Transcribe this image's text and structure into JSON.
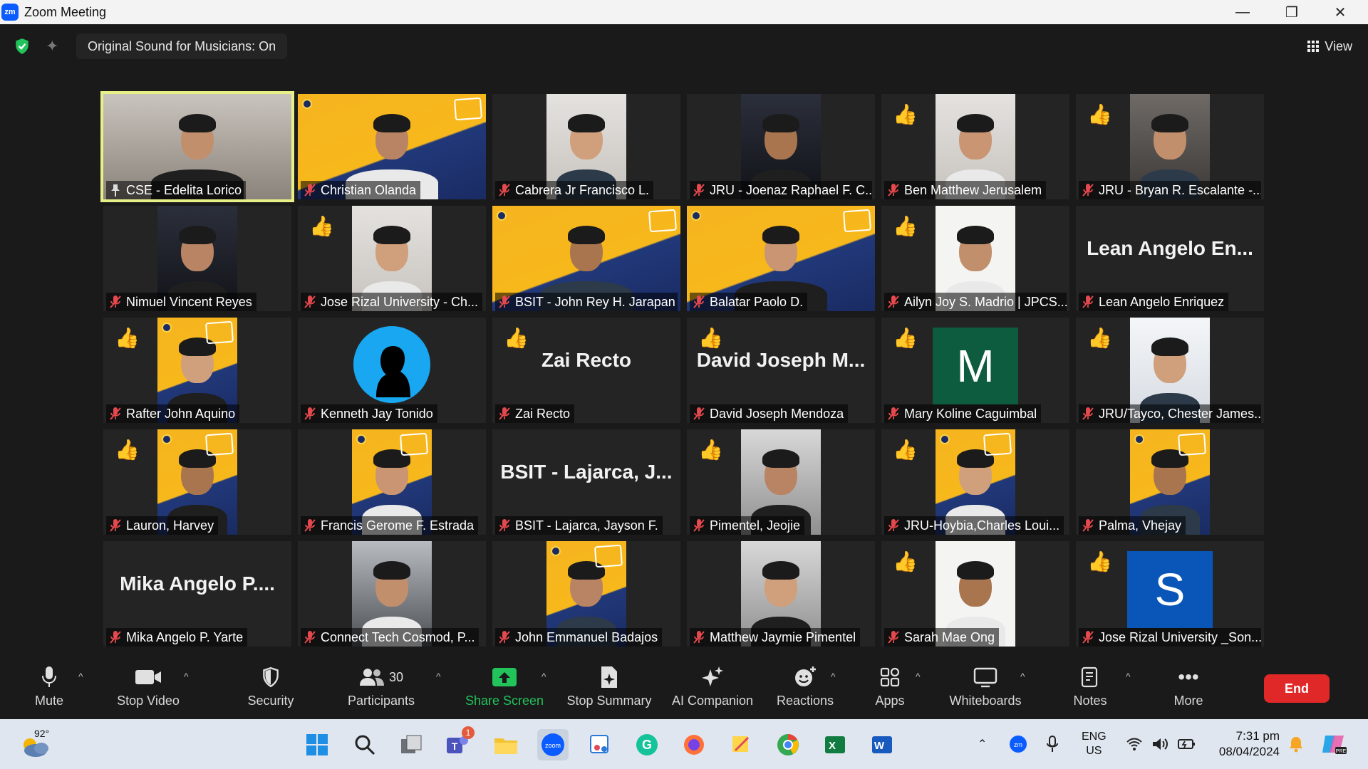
{
  "window": {
    "title": "Zoom Meeting",
    "app_icon": "zm"
  },
  "topbar": {
    "sound_status": "Original Sound for Musicians: On",
    "view_label": "View"
  },
  "participants": [
    {
      "name": "CSE - Edelita Lorico",
      "mic": "on",
      "active": true,
      "kind": "video",
      "bg": "office"
    },
    {
      "name": "Christian Olanda",
      "mic": "muted",
      "kind": "video",
      "bg": "yellow"
    },
    {
      "name": "Cabrera Jr Francisco L.",
      "mic": "muted",
      "kind": "video",
      "bg": "light"
    },
    {
      "name": "JRU - Joenaz Raphael F. C...",
      "mic": "muted",
      "kind": "video",
      "bg": "dark"
    },
    {
      "name": "Ben Matthew Jerusalem",
      "mic": "muted",
      "kind": "video",
      "bg": "light",
      "reaction": "thumbs-up"
    },
    {
      "name": "JRU - Bryan R. Escalante -...",
      "mic": "muted",
      "kind": "video",
      "bg": "room",
      "reaction": "thumbs-up"
    },
    {
      "name": "Nimuel Vincent Reyes",
      "mic": "muted",
      "kind": "video",
      "bg": "dark"
    },
    {
      "name": "Jose Rizal University - Ch...",
      "mic": "muted",
      "kind": "video",
      "bg": "light",
      "reaction": "thumbs-up"
    },
    {
      "name": "BSIT - John Rey H. Jarapan",
      "mic": "muted",
      "kind": "video",
      "bg": "yellow"
    },
    {
      "name": "Balatar Paolo D.",
      "mic": "muted",
      "kind": "video",
      "bg": "yellow"
    },
    {
      "name": "Ailyn Joy S. Madrio | JPCS...",
      "mic": "muted",
      "kind": "video",
      "bg": "white",
      "reaction": "thumbs-up"
    },
    {
      "name": "Lean Angelo Enriquez",
      "mic": "muted",
      "kind": "name",
      "display": "Lean Angelo En..."
    },
    {
      "name": "Rafter John Aquino",
      "mic": "muted",
      "kind": "video",
      "bg": "yellow",
      "reaction": "thumbs-up"
    },
    {
      "name": "Kenneth Jay Tonido",
      "mic": "muted",
      "kind": "silhouette"
    },
    {
      "name": "Zai Recto",
      "mic": "muted",
      "kind": "name",
      "display": "Zai Recto",
      "reaction": "thumbs-up"
    },
    {
      "name": "David Joseph Mendoza",
      "mic": "muted",
      "kind": "name",
      "display": "David Joseph M...",
      "reaction": "thumbs-up"
    },
    {
      "name": "Mary Koline Caguimbal",
      "mic": "muted",
      "kind": "letter",
      "letter": "M",
      "color": "#0d5c3f",
      "reaction": "thumbs-up"
    },
    {
      "name": "JRU/Tayco, Chester James...",
      "mic": "muted",
      "kind": "video",
      "bg": "jru",
      "reaction": "thumbs-up"
    },
    {
      "name": "Lauron, Harvey",
      "mic": "muted",
      "kind": "video",
      "bg": "yellow",
      "reaction": "thumbs-up"
    },
    {
      "name": "Francis Gerome F. Estrada",
      "mic": "muted",
      "kind": "video",
      "bg": "yellow"
    },
    {
      "name": "BSIT - Lajarca, Jayson F.",
      "mic": "muted",
      "kind": "name",
      "display": "BSIT - Lajarca, J..."
    },
    {
      "name": "Pimentel, Jeojie",
      "mic": "muted",
      "kind": "video",
      "bg": "studio",
      "reaction": "thumbs-up"
    },
    {
      "name": "JRU-Hoybia,Charles Loui...",
      "mic": "muted",
      "kind": "video",
      "bg": "yellow",
      "reaction": "thumbs-up"
    },
    {
      "name": "Palma, Vhejay",
      "mic": "muted",
      "kind": "video",
      "bg": "yellow"
    },
    {
      "name": "Mika Angelo P. Yarte",
      "mic": "muted",
      "kind": "name",
      "display": "Mika Angelo P...."
    },
    {
      "name": "Connect Tech Cosmod, P...",
      "mic": "muted",
      "kind": "video",
      "bg": "car"
    },
    {
      "name": "John Emmanuel Badajos",
      "mic": "muted",
      "kind": "video",
      "bg": "yellow"
    },
    {
      "name": "Matthew Jaymie Pimentel",
      "mic": "muted",
      "kind": "video",
      "bg": "studio"
    },
    {
      "name": "Sarah Mae Ong",
      "mic": "muted",
      "kind": "video",
      "bg": "white",
      "reaction": "thumbs-up"
    },
    {
      "name": "Jose Rizal University _Son...",
      "mic": "muted",
      "kind": "letter",
      "letter": "S",
      "color": "#0a56b8",
      "reaction": "thumbs-up"
    }
  ],
  "toolbar": {
    "mute": "Mute",
    "stop_video": "Stop Video",
    "security": "Security",
    "participants": "Participants",
    "participants_count": "30",
    "share_screen": "Share Screen",
    "stop_summary": "Stop Summary",
    "ai_companion": "AI Companion",
    "reactions": "Reactions",
    "apps": "Apps",
    "whiteboards": "Whiteboards",
    "notes": "Notes",
    "more": "More",
    "end": "End"
  },
  "taskbar": {
    "weather_temp": "92°",
    "teams_badge": "1",
    "lang_top": "ENG",
    "lang_bottom": "US",
    "time": "7:31 pm",
    "date": "08/04/2024"
  },
  "colors": {
    "accent_green": "#22c35b",
    "end_red": "#e02828",
    "active_outline": "#e7f087",
    "muted_red": "#e5484d"
  }
}
